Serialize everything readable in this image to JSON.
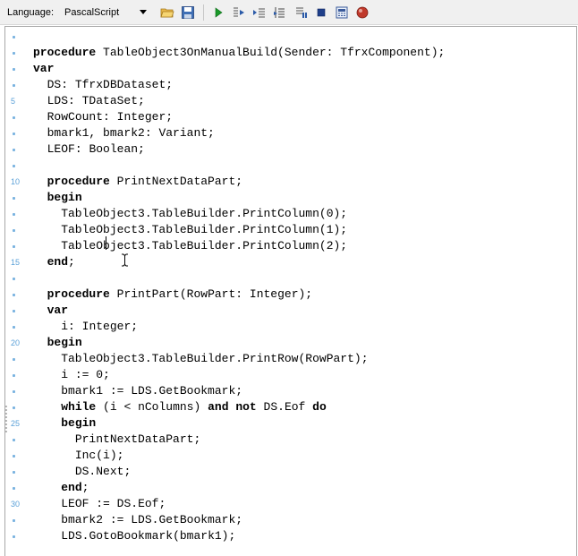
{
  "toolbar": {
    "language_label": "Language:",
    "language_value": "PascalScript",
    "buttons": [
      {
        "name": "open-button",
        "icon": "folder-open-icon"
      },
      {
        "name": "save-button",
        "icon": "floppy-disk-icon"
      },
      {
        "name": "run-button",
        "icon": "run-triangle-icon"
      },
      {
        "name": "step-into-button",
        "icon": "step-into-icon"
      },
      {
        "name": "step-over-button",
        "icon": "step-over-icon"
      },
      {
        "name": "run-to-cursor-button",
        "icon": "run-to-cursor-icon"
      },
      {
        "name": "pause-button",
        "icon": "pause-icon"
      },
      {
        "name": "stop-button",
        "icon": "stop-square-icon"
      },
      {
        "name": "evaluate-button",
        "icon": "evaluate-calculator-icon"
      },
      {
        "name": "breakpoint-button",
        "icon": "breakpoint-icon"
      }
    ]
  },
  "editor": {
    "gutter": {
      "numbered_lines": [
        "5",
        "10",
        "15",
        "20",
        "25",
        "30"
      ]
    },
    "lines": [
      "",
      "procedure TableObject3OnManualBuild(Sender: TfrxComponent);",
      "var",
      "  DS: TfrxDBDataset;",
      "  LDS: TDataSet;",
      "  RowCount: Integer;",
      "  bmark1, bmark2: Variant;",
      "  LEOF: Boolean;",
      "",
      "  procedure PrintNextDataPart;",
      "  begin",
      "    TableObject3.TableBuilder.PrintColumn(0);",
      "    TableObject3.TableBuilder.PrintColumn(1);",
      "    TableObject3.TableBuilder.PrintColumn(2);",
      "  end;",
      "",
      "  procedure PrintPart(RowPart: Integer);",
      "  var",
      "    i: Integer;",
      "  begin",
      "    TableObject3.TableBuilder.PrintRow(RowPart);",
      "    i := 0;",
      "    bmark1 := LDS.GetBookmark;",
      "    while (i < nColumns) and not DS.Eof do",
      "    begin",
      "      PrintNextDataPart;",
      "      Inc(i);",
      "      DS.Next;",
      "    end;",
      "    LEOF := DS.Eof;",
      "    bmark2 := LDS.GetBookmark;",
      "    LDS.GotoBookmark(bmark1);"
    ],
    "keywords": [
      "procedure",
      "var",
      "begin",
      "end",
      "while",
      "and",
      "not",
      "do"
    ],
    "colors": {
      "gutter_number": "#5aa0d8",
      "gutter_dot": "#7ab3e0",
      "text": "#000000",
      "background": "#ffffff"
    }
  }
}
